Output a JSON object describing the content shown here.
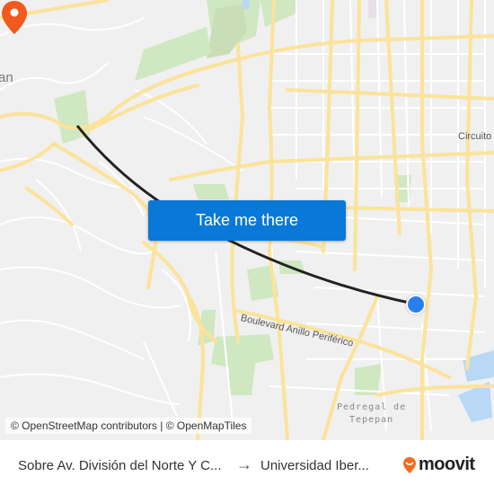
{
  "map": {
    "labels": {
      "left_partial": "an",
      "circuito": "Circuito",
      "boulevard": "Boulevard Anillo Periférico",
      "pedregal_line1": "Pedregal de",
      "pedregal_line2": "Tepepan"
    },
    "attribution": "© OpenStreetMap contributors | © OpenMapTiles",
    "route_color": "#222222",
    "origin_marker_color": "#2a7ff0",
    "destination_marker_color": "#f05a1e",
    "icons": {
      "destination": "map-pin-icon",
      "origin": "location-dot-icon"
    }
  },
  "cta": {
    "label": "Take me there",
    "color": "#0a78d7"
  },
  "footer": {
    "from": "Sobre Av. División del Norte Y C...",
    "arrow": "→",
    "to": "Universidad Iber...",
    "brand": "moovit",
    "brand_color": "#f26b21"
  }
}
